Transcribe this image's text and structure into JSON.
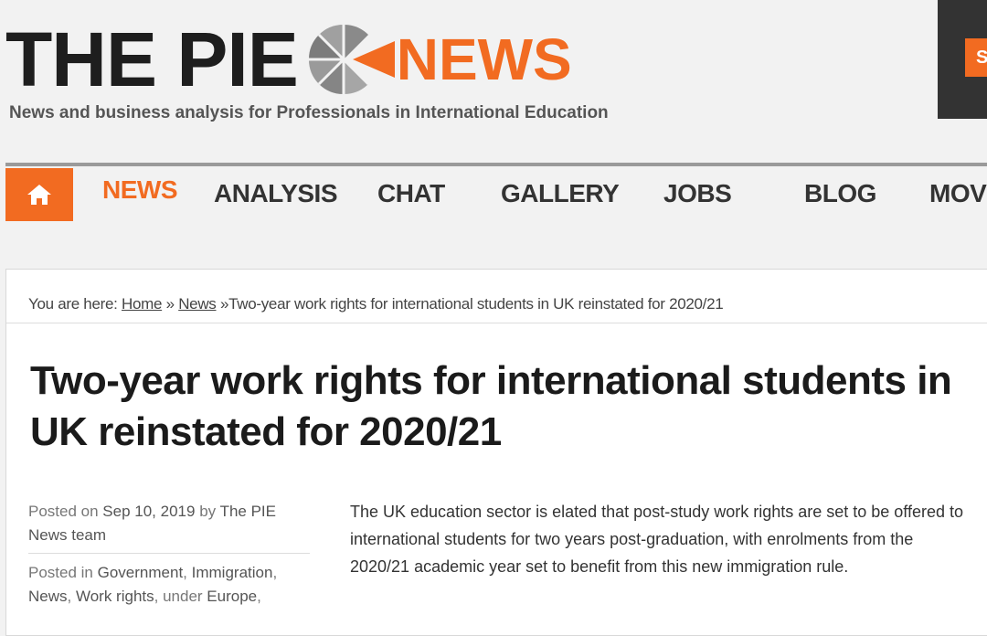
{
  "header": {
    "logo_the_pie": "THE PIE",
    "logo_news": "NEWS",
    "tagline": "News and business analysis for Professionals in International Education",
    "corner_button_label": "S"
  },
  "nav": {
    "items": [
      {
        "label": "NEWS",
        "active": true
      },
      {
        "label": "ANALYSIS",
        "active": false
      },
      {
        "label": "CHAT",
        "active": false
      },
      {
        "label": "GALLERY",
        "active": false
      },
      {
        "label": "JOBS",
        "active": false
      },
      {
        "label": "BLOG",
        "active": false
      },
      {
        "label": "MOVE",
        "active": false
      }
    ],
    "home_icon": "home-icon"
  },
  "breadcrumb": {
    "prefix": "You are here:",
    "home": "Home",
    "sep": "»",
    "section": "News",
    "current": "Two-year work rights for international students in UK reinstated for 2020/21"
  },
  "article": {
    "title": "Two-year work rights for international students in UK reinstated for 2020/21",
    "posted_on_label": "Posted on",
    "posted_date": "Sep 10, 2019",
    "by_label": "by",
    "author": "The PIE News team",
    "posted_in_label": "Posted in",
    "categories": [
      "Government",
      "Immigration",
      "News",
      "Work rights"
    ],
    "under_label": "under",
    "region": "Europe",
    "lead": "The UK education sector is elated that post-study work rights are set to be offered to international students for two years post-graduation, with enrolments from the 2020/21 academic year set to benefit from this new immigration rule."
  },
  "colors": {
    "accent": "#f26b21",
    "text": "#1e1e1e",
    "background": "#f2f2f2"
  }
}
